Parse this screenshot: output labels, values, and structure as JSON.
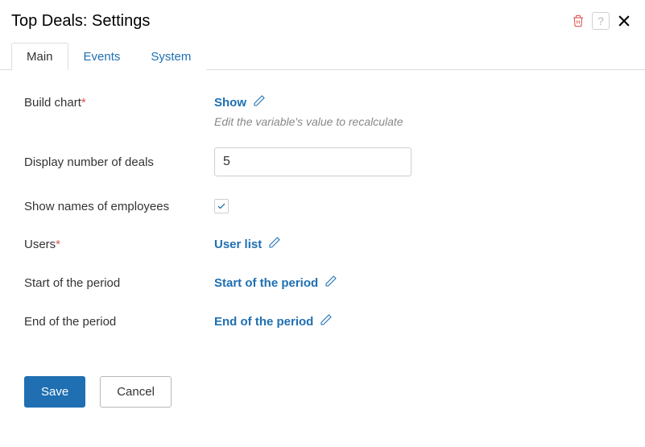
{
  "header": {
    "title": "Top Deals: Settings"
  },
  "tabs": {
    "main": "Main",
    "events": "Events",
    "system": "System"
  },
  "form": {
    "build_chart": {
      "label": "Build chart",
      "value": "Show",
      "hint": "Edit the variable's value to recalculate"
    },
    "display_number": {
      "label": "Display number of deals",
      "value": "5"
    },
    "show_names": {
      "label": "Show names of employees",
      "checked": true
    },
    "users": {
      "label": "Users",
      "value": "User list"
    },
    "start_period": {
      "label": "Start of the period",
      "value": "Start of the period"
    },
    "end_period": {
      "label": "End of the period",
      "value": "End of the period"
    }
  },
  "buttons": {
    "save": "Save",
    "cancel": "Cancel"
  }
}
